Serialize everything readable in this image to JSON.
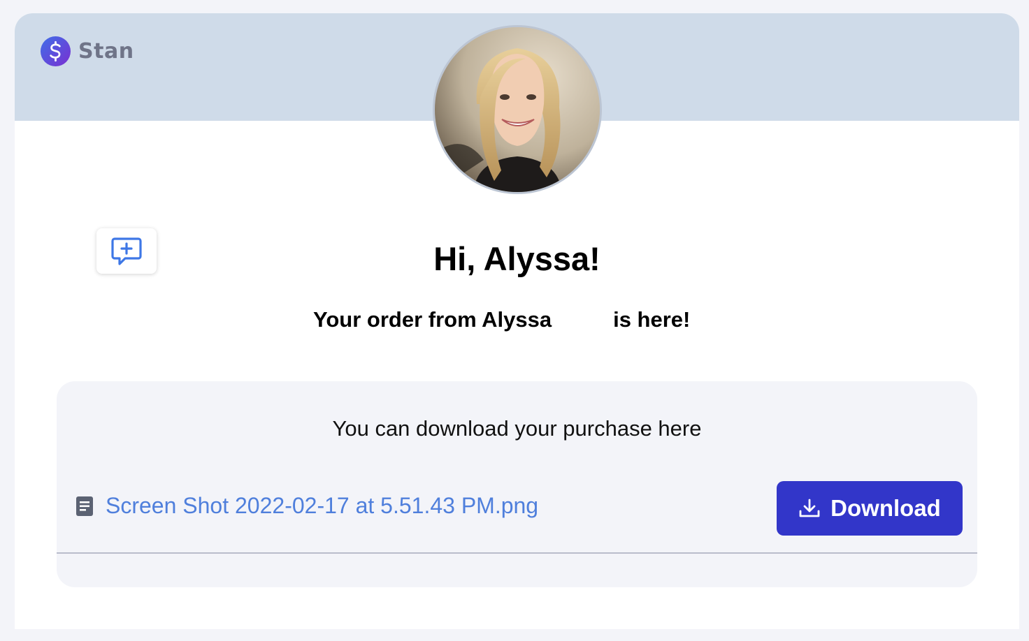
{
  "brand": {
    "name": "Stan",
    "color": "#5b3fd6"
  },
  "greeting": "Hi, Alyssa!",
  "order_message": {
    "prefix": "Your order from Alyssa",
    "suffix": "is here!"
  },
  "download_panel": {
    "heading": "You can download your purchase here",
    "file_name": "Screen Shot 2022-02-17 at 5.51.43 PM.png",
    "file_icon": "document-icon",
    "download_label": "Download",
    "download_icon": "download-icon"
  },
  "feedback_icon": "message-plus-icon",
  "colors": {
    "header_band": "#cfdbe9",
    "accent_button": "#3236c9",
    "link": "#4f7fdc",
    "panel_bg": "#f3f4f9"
  }
}
